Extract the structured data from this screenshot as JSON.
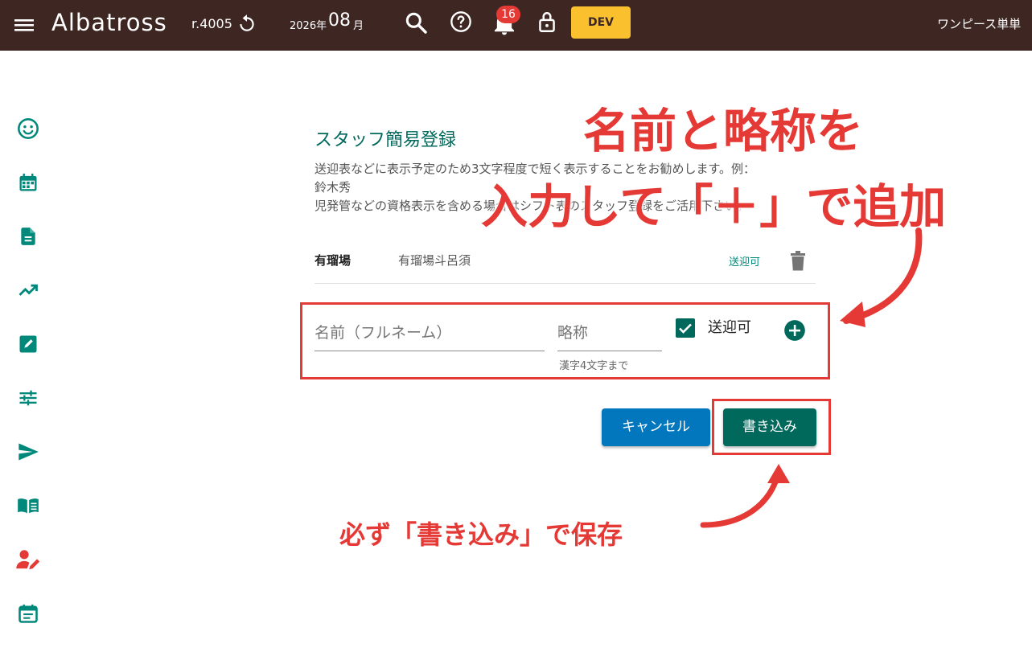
{
  "header": {
    "brand": "Albatross",
    "revision": "r.4005",
    "year": "2026年",
    "month": "08",
    "month_unit": "月",
    "notification_count": "16",
    "dev_label": "DEV",
    "user_name": "ワンピース単単"
  },
  "sidebar": {
    "items": [
      {
        "icon": "smiley-icon"
      },
      {
        "icon": "calendar-icon"
      },
      {
        "icon": "document-icon"
      },
      {
        "icon": "trending-up-icon"
      },
      {
        "icon": "edit-note-icon"
      },
      {
        "icon": "tune-icon"
      },
      {
        "icon": "send-icon"
      },
      {
        "icon": "book-icon"
      },
      {
        "icon": "person-edit-icon"
      },
      {
        "icon": "event-note-icon"
      }
    ]
  },
  "dialog": {
    "title": "スタッフ簡易登録",
    "description_line1": "送迎表などに表示予定のため3文字程度で短く表示することをお勧めします。例：",
    "description_line2": "鈴木秀",
    "description_line3": "児発管などの資格表示を含める場合はシフト表のスタッフ登録をご活用下さい。",
    "staff": [
      {
        "abbr": "有瑠場",
        "name": "有瑠場斗呂須",
        "pickup": "送迎可"
      }
    ],
    "form": {
      "name_placeholder": "名前（フルネーム）",
      "abbr_placeholder": "略称",
      "abbr_hint": "漢字4文字まで",
      "pickup_label": "送迎可",
      "pickup_checked": true
    },
    "cancel_label": "キャンセル",
    "save_label": "書き込み"
  },
  "annotations": {
    "line1": "名前と略称を",
    "line2": "入力して「＋」で追加",
    "save_note": "必ず「書き込み」で保存"
  },
  "colors": {
    "topbar": "#3e2723",
    "accent": "#00695c",
    "annotation": "#e53935",
    "cancel": "#0277bd",
    "dev": "#fbc02d"
  }
}
